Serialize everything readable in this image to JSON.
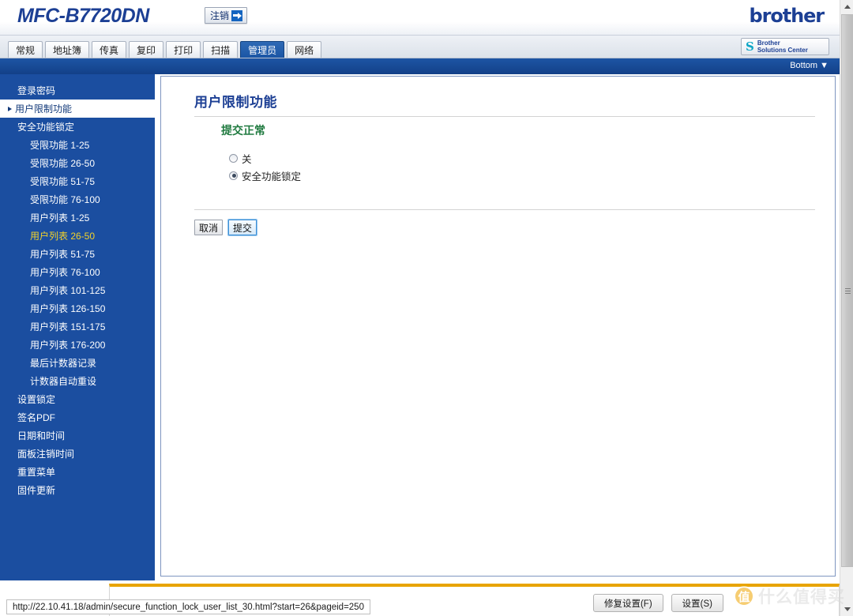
{
  "header": {
    "model": "MFC-B7720DN",
    "logout_label": "注销",
    "logout_icon": "arrow-right-icon",
    "brand": "brother",
    "solutions_mark": "S",
    "solutions_line1": "Brother",
    "solutions_line2": "Solutions Center"
  },
  "tabs": [
    {
      "label": "常规",
      "active": false
    },
    {
      "label": "地址簿",
      "active": false
    },
    {
      "label": "传真",
      "active": false
    },
    {
      "label": "复印",
      "active": false
    },
    {
      "label": "打印",
      "active": false
    },
    {
      "label": "扫描",
      "active": false
    },
    {
      "label": "管理员",
      "active": true
    },
    {
      "label": "网络",
      "active": false
    }
  ],
  "bluebar": {
    "bottom_link": "Bottom ▼"
  },
  "sidebar": {
    "items": [
      {
        "label": "登录密码",
        "level": 1,
        "state": "normal"
      },
      {
        "label": "用户限制功能",
        "level": 1,
        "state": "selected"
      },
      {
        "label": "安全功能锁定",
        "level": 1,
        "state": "normal"
      },
      {
        "label": "受限功能 1-25",
        "level": 2,
        "state": "normal"
      },
      {
        "label": "受限功能 26-50",
        "level": 2,
        "state": "normal"
      },
      {
        "label": "受限功能 51-75",
        "level": 2,
        "state": "normal"
      },
      {
        "label": "受限功能 76-100",
        "level": 2,
        "state": "normal"
      },
      {
        "label": "用户列表 1-25",
        "level": 2,
        "state": "normal"
      },
      {
        "label": "用户列表 26-50",
        "level": 2,
        "state": "highlight"
      },
      {
        "label": "用户列表 51-75",
        "level": 2,
        "state": "normal"
      },
      {
        "label": "用户列表 76-100",
        "level": 2,
        "state": "normal"
      },
      {
        "label": "用户列表 101-125",
        "level": 2,
        "state": "normal"
      },
      {
        "label": "用户列表 126-150",
        "level": 2,
        "state": "normal"
      },
      {
        "label": "用户列表 151-175",
        "level": 2,
        "state": "normal"
      },
      {
        "label": "用户列表 176-200",
        "level": 2,
        "state": "normal"
      },
      {
        "label": "最后计数器记录",
        "level": 2,
        "state": "normal"
      },
      {
        "label": "计数器自动重设",
        "level": 2,
        "state": "normal"
      },
      {
        "label": "设置锁定",
        "level": 1,
        "state": "normal"
      },
      {
        "label": "签名PDF",
        "level": 1,
        "state": "normal"
      },
      {
        "label": "日期和时间",
        "level": 1,
        "state": "normal"
      },
      {
        "label": "面板注销时间",
        "level": 1,
        "state": "normal"
      },
      {
        "label": "重置菜单",
        "level": 1,
        "state": "normal"
      },
      {
        "label": "固件更新",
        "level": 1,
        "state": "normal"
      }
    ]
  },
  "main": {
    "page_title": "用户限制功能",
    "status_message": "提交正常",
    "radios": [
      {
        "label": "关",
        "checked": false
      },
      {
        "label": "安全功能锁定",
        "checked": true
      }
    ],
    "cancel_label": "取消",
    "submit_label": "提交"
  },
  "notification": {
    "message": "",
    "fix_label": "修复设置(F)",
    "settings_label": "设置(S)"
  },
  "statusbar": {
    "url": "http://22.10.41.18/admin/secure_function_lock_user_list_30.html?start=26&pageid=250"
  },
  "watermark": {
    "badge": "值",
    "text": "什么值得买"
  },
  "colors": {
    "brand_blue": "#1c3f94",
    "sidebar_blue": "#1b4ea0",
    "active_tab": "#1b56a5",
    "status_green": "#1f7a3f",
    "highlight_yellow": "#f2d12a",
    "notify_orange": "#e8a400"
  }
}
